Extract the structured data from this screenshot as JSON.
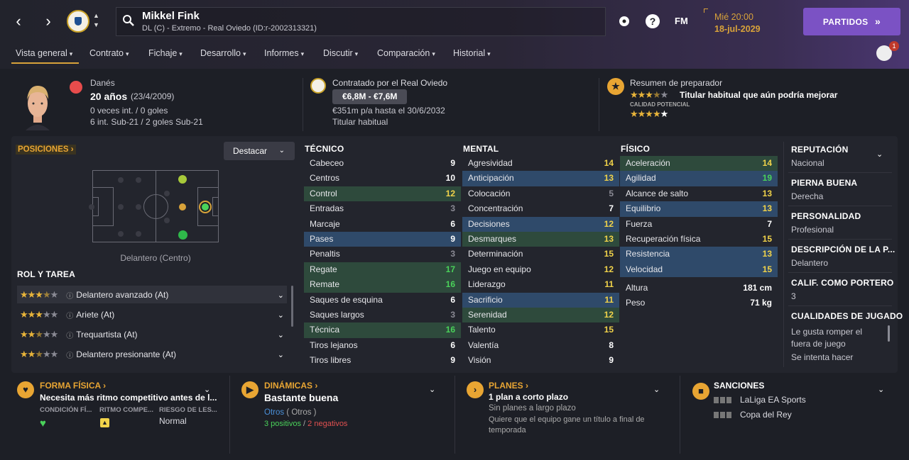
{
  "header": {
    "player_name": "Mikkel Fink",
    "subtitle": "DL (C) - Extremo - Real Oviedo (ID:r-2002313321)",
    "fm_label": "FM",
    "date_time": "Mié 20:00",
    "date": "18-jul-2029",
    "continue_button": "PARTIDOS",
    "notification_count": "1"
  },
  "menu": [
    "Vista general",
    "Contrato",
    "Fichaje",
    "Desarrollo",
    "Informes",
    "Discutir",
    "Comparación",
    "Historial"
  ],
  "profile": {
    "nationality": "Danés",
    "age": "20 años",
    "dob": "(23/4/2009)",
    "caps": "0 veces int. / 0 goles",
    "u21": "6 int. Sub-21 / 2 goles Sub-21",
    "contract_by": "Contratado por el Real Oviedo",
    "value": "€6,8M - €7,6M",
    "wage": "€351m p/a hasta el 30/6/2032",
    "squad_status": "Titular habitual",
    "coach_summary_title": "Resumen de preparador",
    "coach_summary": "Titular habitual que aún podría mejorar",
    "potential_label": "CALIDAD POTENCIAL",
    "current_stars": 3.5,
    "potential_stars": 4
  },
  "positions": {
    "title": "POSICIONES",
    "highlight_button": "Destacar",
    "position_label": "Delantero (Centro)",
    "roles_title": "ROL Y TAREA",
    "roles": [
      {
        "name": "Delantero avanzado (At)",
        "stars": 3.5
      },
      {
        "name": "Ariete (At)",
        "stars": 3
      },
      {
        "name": "Trequartista (At)",
        "stars": 2.5
      },
      {
        "name": "Delantero presionante (At)",
        "stars": 2.5
      }
    ]
  },
  "attributes": {
    "tecnico_title": "TÉCNICO",
    "mental_title": "MENTAL",
    "fisico_title": "FÍSICO",
    "tecnico": [
      {
        "n": "Cabeceo",
        "v": "9"
      },
      {
        "n": "Centros",
        "v": "10"
      },
      {
        "n": "Control",
        "v": "12"
      },
      {
        "n": "Entradas",
        "v": "3"
      },
      {
        "n": "Marcaje",
        "v": "6"
      },
      {
        "n": "Pases",
        "v": "9"
      },
      {
        "n": "Penaltis",
        "v": "3"
      },
      {
        "n": "Regate",
        "v": "17"
      },
      {
        "n": "Remate",
        "v": "16"
      },
      {
        "n": "Saques de esquina",
        "v": "6"
      },
      {
        "n": "Saques largos",
        "v": "3"
      },
      {
        "n": "Técnica",
        "v": "16"
      },
      {
        "n": "Tiros lejanos",
        "v": "6"
      },
      {
        "n": "Tiros libres",
        "v": "9"
      }
    ],
    "mental": [
      {
        "n": "Agresividad",
        "v": "14"
      },
      {
        "n": "Anticipación",
        "v": "13"
      },
      {
        "n": "Colocación",
        "v": "5"
      },
      {
        "n": "Concentración",
        "v": "7"
      },
      {
        "n": "Decisiones",
        "v": "12"
      },
      {
        "n": "Desmarques",
        "v": "13"
      },
      {
        "n": "Determinación",
        "v": "15"
      },
      {
        "n": "Juego en equipo",
        "v": "12"
      },
      {
        "n": "Liderazgo",
        "v": "11"
      },
      {
        "n": "Sacrificio",
        "v": "11"
      },
      {
        "n": "Serenidad",
        "v": "12"
      },
      {
        "n": "Talento",
        "v": "15"
      },
      {
        "n": "Valentía",
        "v": "8"
      },
      {
        "n": "Visión",
        "v": "9"
      }
    ],
    "fisico": [
      {
        "n": "Aceleración",
        "v": "14"
      },
      {
        "n": "Agilidad",
        "v": "19"
      },
      {
        "n": "Alcance de salto",
        "v": "13"
      },
      {
        "n": "Equilibrio",
        "v": "13"
      },
      {
        "n": "Fuerza",
        "v": "7"
      },
      {
        "n": "Recuperación física",
        "v": "15"
      },
      {
        "n": "Resistencia",
        "v": "13"
      },
      {
        "n": "Velocidad",
        "v": "15"
      }
    ],
    "height_label": "Altura",
    "height": "181 cm",
    "weight_label": "Peso",
    "weight": "71 kg"
  },
  "sidebar": {
    "rep_title": "REPUTACIÓN",
    "rep": "Nacional",
    "foot_title": "PIERNA BUENA",
    "foot": "Derecha",
    "pers_title": "PERSONALIDAD",
    "pers": "Profesional",
    "desc_title": "DESCRIPCIÓN DE LA P...",
    "desc": "Delantero",
    "gk_title": "CALIF. COMO PORTERO",
    "gk": "3",
    "traits_title": "CUALIDADES DE JUGADO",
    "trait1": "Le gusta romper el fuera de juego",
    "trait2": "Se intenta hacer"
  },
  "bottom": {
    "forma_title": "FORMA FÍSICA",
    "forma_text": "Necesita más ritmo competitivo antes de l...",
    "cond_label": "CONDICIÓN FÍ...",
    "ritmo_label": "RITMO COMPE...",
    "riesgo_label": "RIESGO DE LES...",
    "riesgo": "Normal",
    "din_title": "DINÁMICAS",
    "din_text": "Bastante buena",
    "otros": "Otros",
    "otros2": "( Otros )",
    "positivos": "3 positivos",
    "slash": "/",
    "negativos": "2 negativos",
    "planes_title": "PLANES",
    "planes_text": "1 plan a corto plazo",
    "planes_sub1": "Sin planes a largo plazo",
    "planes_sub2": "Quiere que el equipo gane un título a final de temporada",
    "sanc_title": "SANCIONES",
    "sanc1": "LaLiga EA Sports",
    "sanc2": "Copa del Rey"
  },
  "colors": {
    "accent": "#d8a23a",
    "purple": "#7b52c4",
    "highlight_blue": "#2f4a6a",
    "highlight_green": "#2e4a3c"
  }
}
